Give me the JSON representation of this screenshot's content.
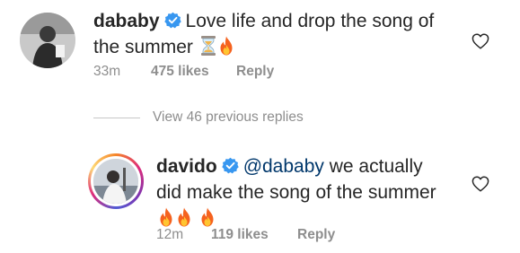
{
  "colors": {
    "text": "#262626",
    "meta": "#8e8e8e",
    "mention": "#00376b",
    "verified_badge": "#3897f0"
  },
  "comment_1": {
    "username": "dababy",
    "verified_icon": "verified-badge-icon",
    "text": "Love life and drop the song of the summer",
    "emojis": [
      "hourglass-emoji",
      "fire-emoji"
    ],
    "time": "33m",
    "likes": "475 likes",
    "reply": "Reply",
    "like_icon": "heart-outline-icon"
  },
  "view_replies": {
    "label": "View 46 previous replies"
  },
  "comment_2": {
    "username": "davido",
    "verified_icon": "verified-badge-icon",
    "mention": "@dababy",
    "text": "we actually did make the song of the summer",
    "emojis": [
      "fire-emoji",
      "fire-emoji",
      "fire-emoji"
    ],
    "time": "12m",
    "likes": "119 likes",
    "reply": "Reply",
    "like_icon": "heart-outline-icon"
  }
}
